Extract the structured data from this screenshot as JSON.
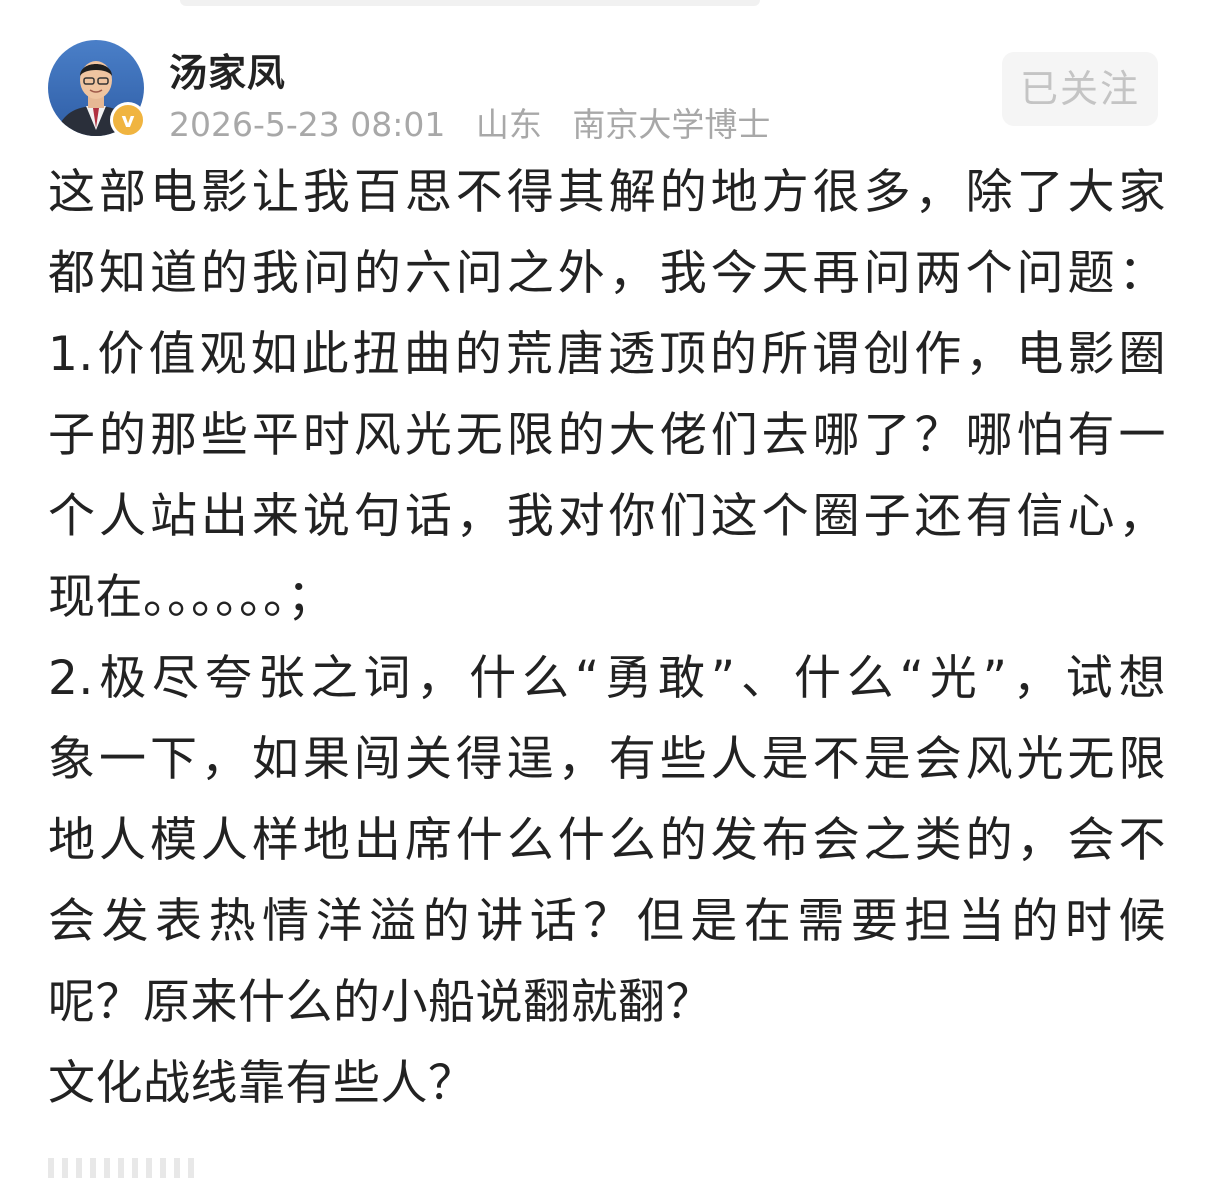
{
  "user": {
    "name": "汤家凤",
    "badge": "v",
    "time": "2026-5-23 08:01",
    "location": "山东",
    "bio": "南京大学博士"
  },
  "follow_button": {
    "label": "已关注"
  },
  "post": {
    "lines": [
      "这部电影让我百思不得其解的地方很多，除了大家",
      "都知道的我问的六问之外，我今天再问两个问题：",
      "1.价值观如此扭曲的荒唐透顶的所谓创作，电影圈",
      "子的那些平时风光无限的大佬们去哪了？哪怕有一",
      "个人站出来说句话，我对你们这个圈子还有信心，",
      "现在。。。。。。；",
      "2.极尽夸张之词，什么“勇敢”、什么“光”，试想",
      "象一下，如果闯关得逞，有些人是不是会风光无限",
      "地人模人样地出席什么什么的发布会之类的，会不",
      "会发表热情洋溢的讲话？但是在需要担当的时候",
      "呢？原来什么的小船说翻就翻？",
      "文化战线靠有些人？"
    ]
  },
  "colors": {
    "text": "#222222",
    "meta": "#a8a8a8",
    "badge": "#f0b440",
    "follow_bg": "#f5f5f5",
    "follow_text": "#c4c4c4"
  }
}
